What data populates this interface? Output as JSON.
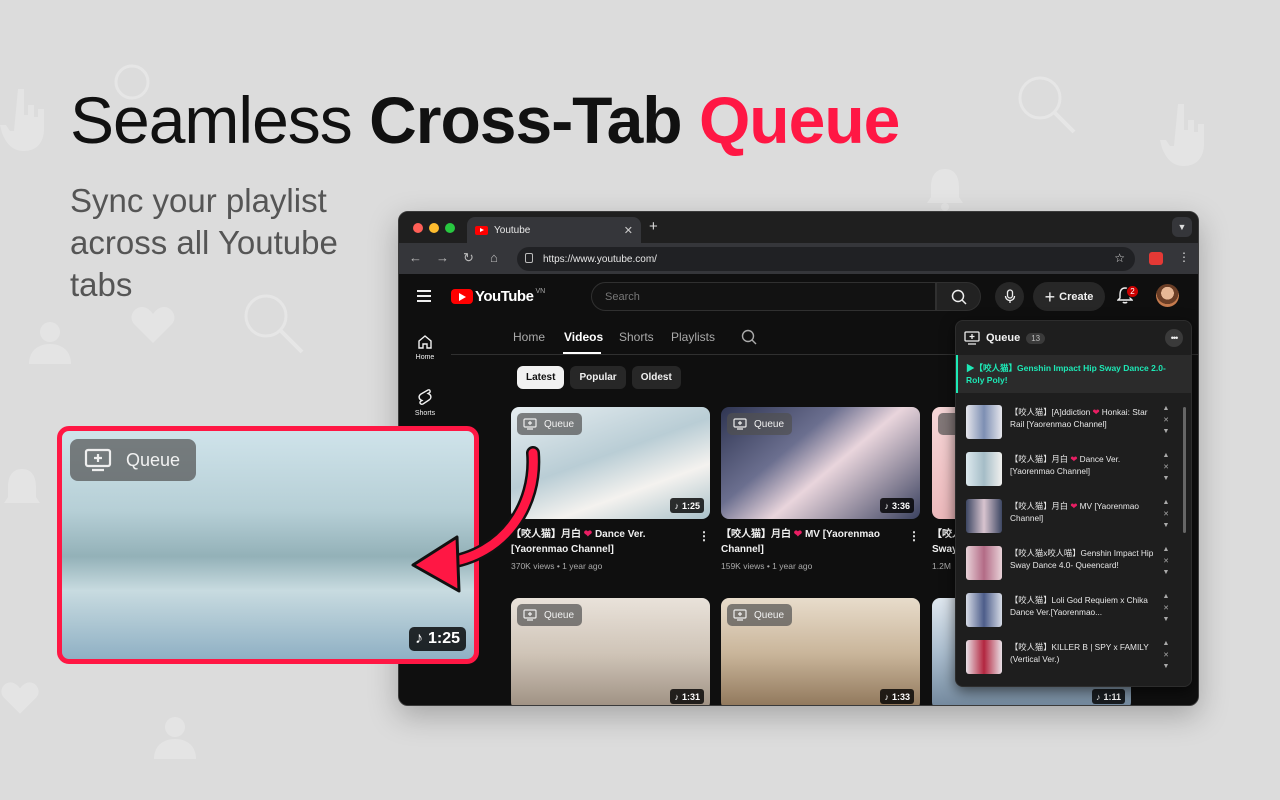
{
  "hero": {
    "title_part1": "Seamless ",
    "title_part2": "Cross-Tab ",
    "title_part3": "Queue",
    "subtitle": "Sync your playlist across all Youtube tabs",
    "accent_color": "#ff1744"
  },
  "browser": {
    "tab_title": "Youtube",
    "new_tab": "+",
    "url": "https://www.youtube.com/"
  },
  "youtube": {
    "logo_text": "YouTube",
    "region": "VN",
    "search_placeholder": "Search",
    "create_label": "Create",
    "notifications_count": "2",
    "sidenav": [
      {
        "label": "Home",
        "icon": "home-icon"
      },
      {
        "label": "Shorts",
        "icon": "shorts-icon"
      }
    ],
    "channel_tabs": [
      "Home",
      "Videos",
      "Shorts",
      "Playlists"
    ],
    "active_tab": "Videos",
    "chips": [
      "Latest",
      "Popular",
      "Oldest"
    ],
    "active_chip": "Latest",
    "queue_button_label": "Queue",
    "videos": [
      {
        "title": "【咬人猫】月白 💗 Dance Ver. [Yaorenmao Channel]",
        "title_a": "【咬人猫】月白 ",
        "title_b": " Dance Ver. [Yaorenmao Channel]",
        "meta": "370K views • 1 year ago",
        "duration": "1:25",
        "thumb_colors": [
          "#dfe9ee",
          "#a9c2cc",
          "#f3f3f1"
        ]
      },
      {
        "title": "【咬人猫】月白 💗 MV [Yaorenmao Channel]",
        "title_a": "【咬人猫】月白 ",
        "title_b": " MV [Yaorenmao Channel]",
        "meta": "159K views • 1 year ago",
        "duration": "3:36",
        "thumb_colors": [
          "#3d4763",
          "#e8d6dd",
          "#2c2f45"
        ]
      },
      {
        "title": "【咬人...",
        "title_a": "【咬人...",
        "title_b": "",
        "subline": "Sway",
        "meta": "1.2M",
        "duration": "",
        "thumb_colors": [
          "#f3c7c9",
          "#e8a9ad",
          "#f6dcdc"
        ]
      },
      {
        "title": "",
        "meta": "",
        "duration": "1:31",
        "thumb_colors": [
          "#d8cfc5",
          "#b8aa9a",
          "#efe8e1"
        ]
      },
      {
        "title": "",
        "meta": "",
        "duration": "1:33",
        "thumb_colors": [
          "#d9cbb6",
          "#a88f70",
          "#efe3d2"
        ]
      },
      {
        "title": "",
        "meta": "",
        "duration": "1:11",
        "thumb_colors": [
          "#c7d4e0",
          "#8aa1b6",
          "#e7eef4"
        ]
      }
    ]
  },
  "queue": {
    "title": "Queue",
    "count": "13",
    "now_playing": "▶【咬人猫】Genshin Impact Hip Sway Dance 2.0-Roly Poly!",
    "items": [
      {
        "title": "【咬人猫】[A]ddiction 💗 Honkai: Star Rail [Yaorenmao Channel]",
        "title_a": "【咬人猫】[A]ddiction ",
        "title_b": " Honkai: Star Rail [Yaorenmao Channel]",
        "heart": true,
        "colors": [
          "#e6e6ec",
          "#7d8fb3"
        ]
      },
      {
        "title": "【咬人猫】月白 💗 Dance Ver. [Yaorenmao Channel]",
        "title_a": "【咬人猫】月白 ",
        "title_b": " Dance Ver. [Yaorenmao Channel]",
        "heart": true,
        "colors": [
          "#dde9ee",
          "#a5bdc7"
        ]
      },
      {
        "title": "【咬人猫】月白 💗 MV [Yaorenmao Channel]",
        "title_a": "【咬人猫】月白 ",
        "title_b": " MV [Yaorenmao Channel]",
        "heart": true,
        "colors": [
          "#3d4763",
          "#d8c4cf"
        ]
      },
      {
        "title": "【咬人猫x咬人喵】Genshin Impact Hip Sway Dance 4.0- Queencard!",
        "title_a": "【咬人猫x咬人喵】Genshin Impact Hip Sway Dance 4.0- Queencard!",
        "title_b": "",
        "heart": false,
        "colors": [
          "#e8d2d8",
          "#b36b86"
        ]
      },
      {
        "title": "【咬人猫】Loli God Requiem x Chika Dance Ver.[Yaorenmao...",
        "title_a": "【咬人猫】Loli God Requiem x Chika Dance Ver.[Yaorenmao...",
        "title_b": "",
        "heart": false,
        "colors": [
          "#d6dbe6",
          "#4d5d8a"
        ]
      },
      {
        "title": "【咬人猫】KILLER B | SPY x FAMILY (Vertical Ver.)",
        "title_a": "【咬人猫】KILLER B | SPY x FAMILY (Vertical Ver.)",
        "title_b": "",
        "heart": false,
        "colors": [
          "#e8e0e6",
          "#b3263f"
        ]
      }
    ],
    "controls": [
      "▲",
      "✕",
      "▼"
    ],
    "accent_color": "#1de9b6"
  },
  "callout": {
    "queue_label": "Queue",
    "duration": "1:25",
    "border_color": "#ff1744"
  }
}
